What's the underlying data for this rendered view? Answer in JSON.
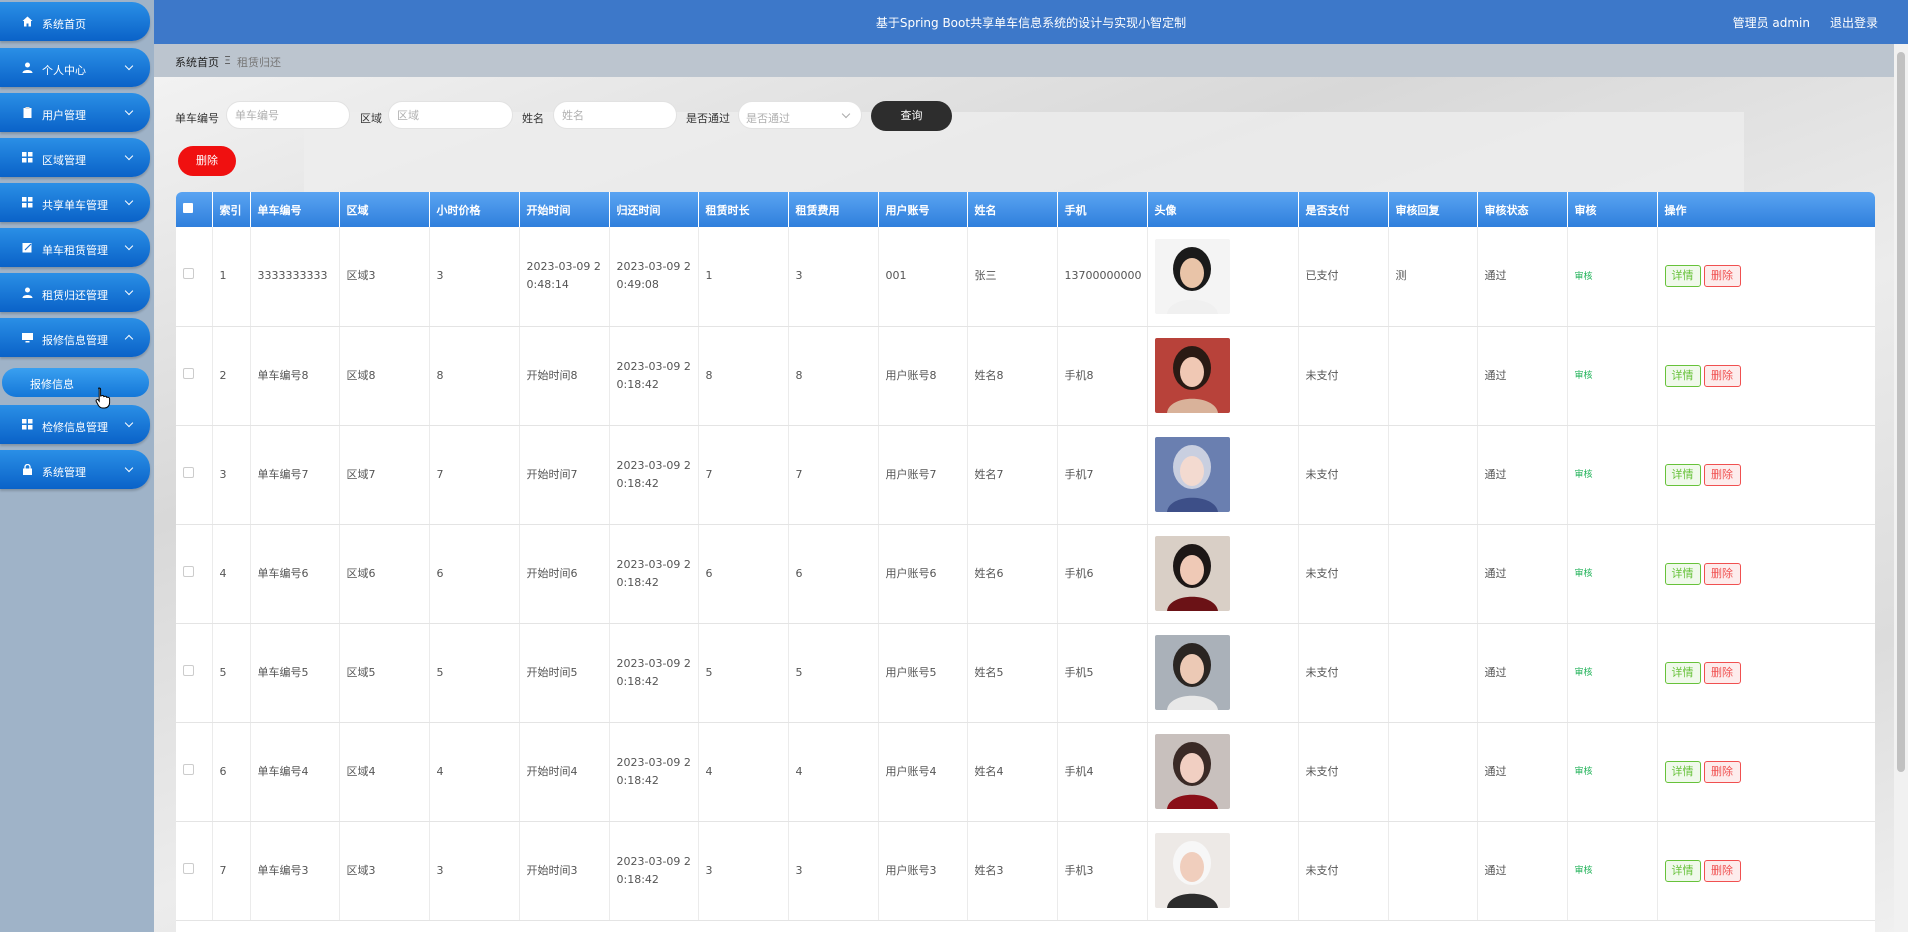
{
  "app": {
    "title": "基于Spring Boot共享单车信息系统的设计与实现小智定制",
    "user_label": "管理员 admin",
    "logout_label": "退出登录"
  },
  "sidebar": {
    "items": [
      {
        "label": "系统首页",
        "icon": "home-icon"
      },
      {
        "label": "个人中心",
        "icon": "user-icon"
      },
      {
        "label": "用户管理",
        "icon": "clipboard-icon"
      },
      {
        "label": "区域管理",
        "icon": "grid-icon"
      },
      {
        "label": "共享单车管理",
        "icon": "grid-icon"
      },
      {
        "label": "单车租赁管理",
        "icon": "edit-icon"
      },
      {
        "label": "租赁归还管理",
        "icon": "user-icon"
      },
      {
        "label": "报修信息管理",
        "icon": "monitor-icon"
      },
      {
        "label": "检修信息管理",
        "icon": "grid-icon"
      },
      {
        "label": "系统管理",
        "icon": "lock-icon"
      }
    ],
    "subitem": {
      "label": "报修信息"
    }
  },
  "breadcrumb": {
    "home": "系统首页",
    "separator": "Ξ",
    "current": "租赁归还"
  },
  "search": {
    "bike_no_label": "单车编号",
    "bike_no_placeholder": "单车编号",
    "area_label": "区域",
    "area_placeholder": "区域",
    "name_label": "姓名",
    "name_placeholder": "姓名",
    "approved_label": "是否通过",
    "approved_placeholder": "是否通过",
    "query_button": "查询",
    "delete_button": "删除"
  },
  "table": {
    "headers": [
      "",
      "索引",
      "单车编号",
      "区域",
      "小时价格",
      "开始时间",
      "归还时间",
      "租赁时长",
      "租赁费用",
      "用户账号",
      "姓名",
      "手机",
      "头像",
      "是否支付",
      "审核回复",
      "审核状态",
      "审核",
      "操作"
    ],
    "audit_label": "审核",
    "detail_label": "详情",
    "delete_label": "删除",
    "rows": [
      {
        "index": "1",
        "bike_no": "3333333333",
        "area": "区域3",
        "price": "3",
        "start": "2023-03-09 20:48:14",
        "end": "2023-03-09 20:49:08",
        "duration": "1",
        "fee": "3",
        "account": "001",
        "name": "张三",
        "phone": "13700000000",
        "paid": "已支付",
        "reply": "测",
        "status": "通过"
      },
      {
        "index": "2",
        "bike_no": "单车编号8",
        "area": "区域8",
        "price": "8",
        "start": "开始时间8",
        "end": "2023-03-09 20:18:42",
        "duration": "8",
        "fee": "8",
        "account": "用户账号8",
        "name": "姓名8",
        "phone": "手机8",
        "paid": "未支付",
        "reply": "",
        "status": "通过"
      },
      {
        "index": "3",
        "bike_no": "单车编号7",
        "area": "区域7",
        "price": "7",
        "start": "开始时间7",
        "end": "2023-03-09 20:18:42",
        "duration": "7",
        "fee": "7",
        "account": "用户账号7",
        "name": "姓名7",
        "phone": "手机7",
        "paid": "未支付",
        "reply": "",
        "status": "通过"
      },
      {
        "index": "4",
        "bike_no": "单车编号6",
        "area": "区域6",
        "price": "6",
        "start": "开始时间6",
        "end": "2023-03-09 20:18:42",
        "duration": "6",
        "fee": "6",
        "account": "用户账号6",
        "name": "姓名6",
        "phone": "手机6",
        "paid": "未支付",
        "reply": "",
        "status": "通过"
      },
      {
        "index": "5",
        "bike_no": "单车编号5",
        "area": "区域5",
        "price": "5",
        "start": "开始时间5",
        "end": "2023-03-09 20:18:42",
        "duration": "5",
        "fee": "5",
        "account": "用户账号5",
        "name": "姓名5",
        "phone": "手机5",
        "paid": "未支付",
        "reply": "",
        "status": "通过"
      },
      {
        "index": "6",
        "bike_no": "单车编号4",
        "area": "区域4",
        "price": "4",
        "start": "开始时间4",
        "end": "2023-03-09 20:18:42",
        "duration": "4",
        "fee": "4",
        "account": "用户账号4",
        "name": "姓名4",
        "phone": "手机4",
        "paid": "未支付",
        "reply": "",
        "status": "通过"
      },
      {
        "index": "7",
        "bike_no": "单车编号3",
        "area": "区域3",
        "price": "3",
        "start": "开始时间3",
        "end": "2023-03-09 20:18:42",
        "duration": "3",
        "fee": "3",
        "account": "用户账号3",
        "name": "姓名3",
        "phone": "手机3",
        "paid": "未支付",
        "reply": "",
        "status": "通过"
      }
    ]
  },
  "colors": {
    "header": "#3d78c9",
    "sidebar_button": "#0a62c8",
    "delete_red": "#f01010",
    "query_dark": "#2d2d2d"
  }
}
